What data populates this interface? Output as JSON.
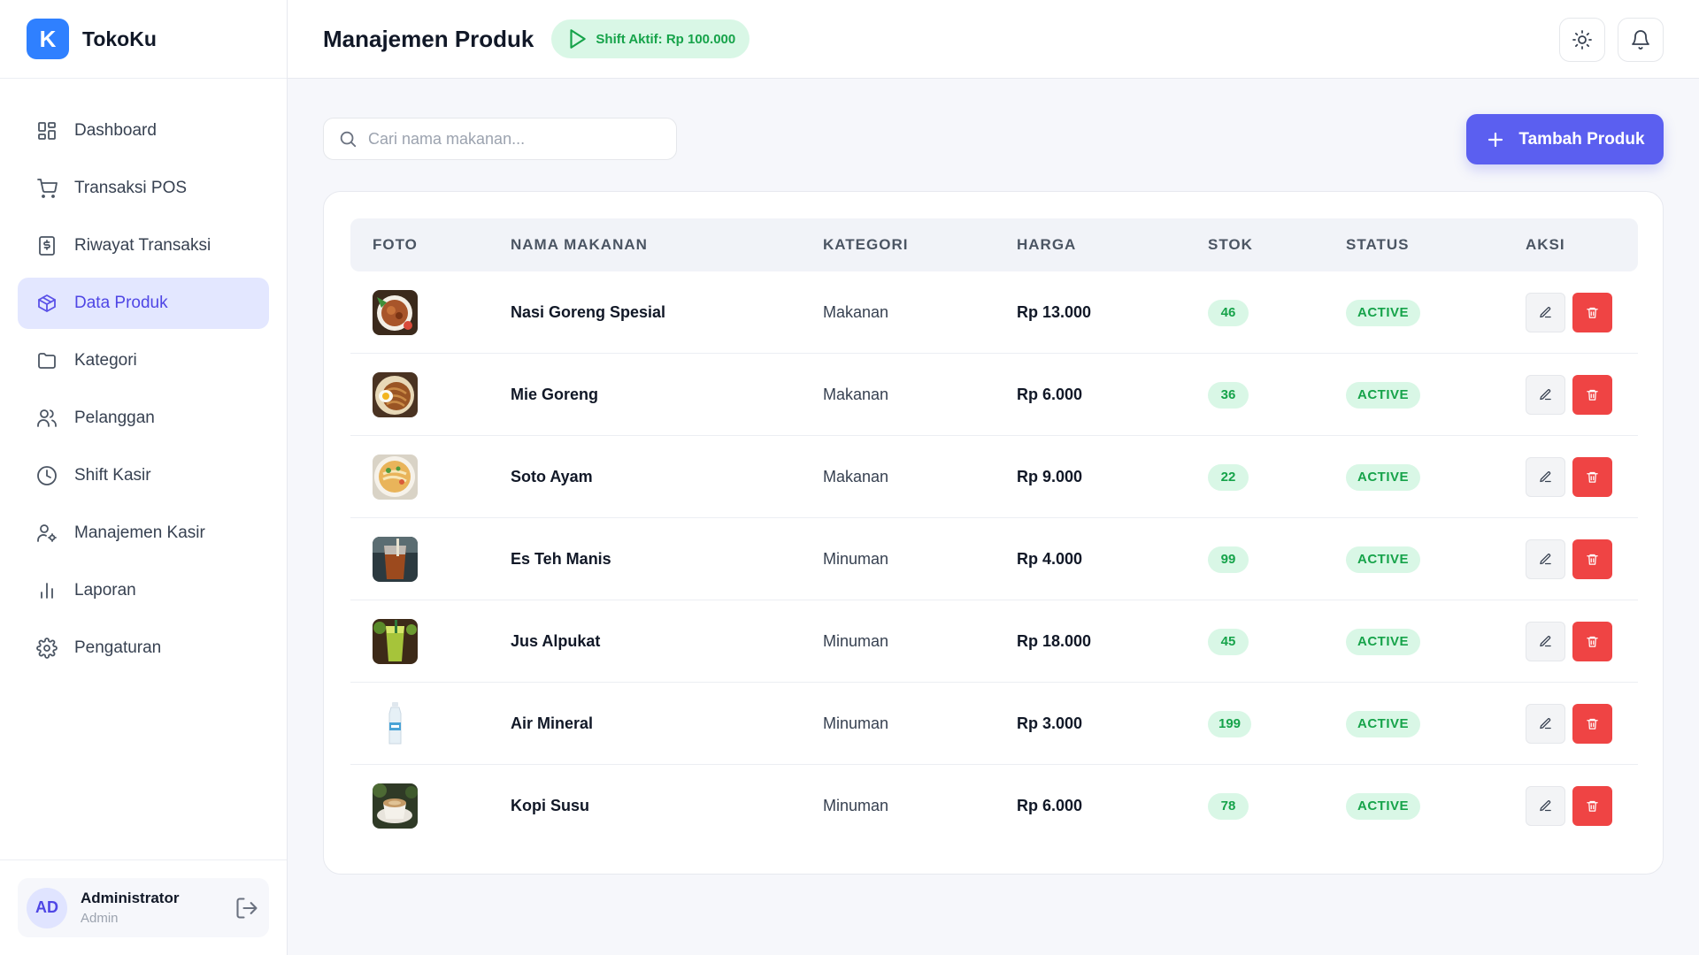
{
  "brand": {
    "logo_letter": "K",
    "name": "TokoKu"
  },
  "sidebar": {
    "items": [
      {
        "label": "Dashboard",
        "icon": "dashboard-icon",
        "active": false
      },
      {
        "label": "Transaksi POS",
        "icon": "cart-icon",
        "active": false
      },
      {
        "label": "Riwayat Transaksi",
        "icon": "receipt-icon",
        "active": false
      },
      {
        "label": "Data Produk",
        "icon": "box-icon",
        "active": true
      },
      {
        "label": "Kategori",
        "icon": "folder-icon",
        "active": false
      },
      {
        "label": "Pelanggan",
        "icon": "users-icon",
        "active": false
      },
      {
        "label": "Shift Kasir",
        "icon": "clock-icon",
        "active": false
      },
      {
        "label": "Manajemen Kasir",
        "icon": "user-gear-icon",
        "active": false
      },
      {
        "label": "Laporan",
        "icon": "bar-chart-icon",
        "active": false
      },
      {
        "label": "Pengaturan",
        "icon": "gear-icon",
        "active": false
      }
    ]
  },
  "user": {
    "initials": "AD",
    "name": "Administrator",
    "role": "Admin"
  },
  "header": {
    "title": "Manajemen Produk",
    "shift_badge": "Shift Aktif: Rp 100.000"
  },
  "search": {
    "placeholder": "Cari nama makanan...",
    "value": ""
  },
  "toolbar": {
    "add_label": "Tambah Produk"
  },
  "table": {
    "columns": [
      "FOTO",
      "NAMA MAKANAN",
      "KATEGORI",
      "HARGA",
      "STOK",
      "STATUS",
      "AKSI"
    ],
    "rows": [
      {
        "name": "Nasi Goreng Spesial",
        "category": "Makanan",
        "price": "Rp 13.000",
        "stock": "46",
        "status": "ACTIVE",
        "photo": "fried-rice"
      },
      {
        "name": "Mie Goreng",
        "category": "Makanan",
        "price": "Rp 6.000",
        "stock": "36",
        "status": "ACTIVE",
        "photo": "fried-noodles"
      },
      {
        "name": "Soto Ayam",
        "category": "Makanan",
        "price": "Rp 9.000",
        "stock": "22",
        "status": "ACTIVE",
        "photo": "soup"
      },
      {
        "name": "Es Teh Manis",
        "category": "Minuman",
        "price": "Rp 4.000",
        "stock": "99",
        "status": "ACTIVE",
        "photo": "iced-tea"
      },
      {
        "name": "Jus Alpukat",
        "category": "Minuman",
        "price": "Rp 18.000",
        "stock": "45",
        "status": "ACTIVE",
        "photo": "avocado-juice"
      },
      {
        "name": "Air Mineral",
        "category": "Minuman",
        "price": "Rp 3.000",
        "stock": "199",
        "status": "ACTIVE",
        "photo": "water-bottle"
      },
      {
        "name": "Kopi Susu",
        "category": "Minuman",
        "price": "Rp 6.000",
        "stock": "78",
        "status": "ACTIVE",
        "photo": "coffee"
      }
    ]
  },
  "colors": {
    "accent": "#5b5ff0",
    "brand": "#2f80ff",
    "success": "#16a34a",
    "success_bg": "#d9f7e6",
    "danger": "#ef4444"
  }
}
